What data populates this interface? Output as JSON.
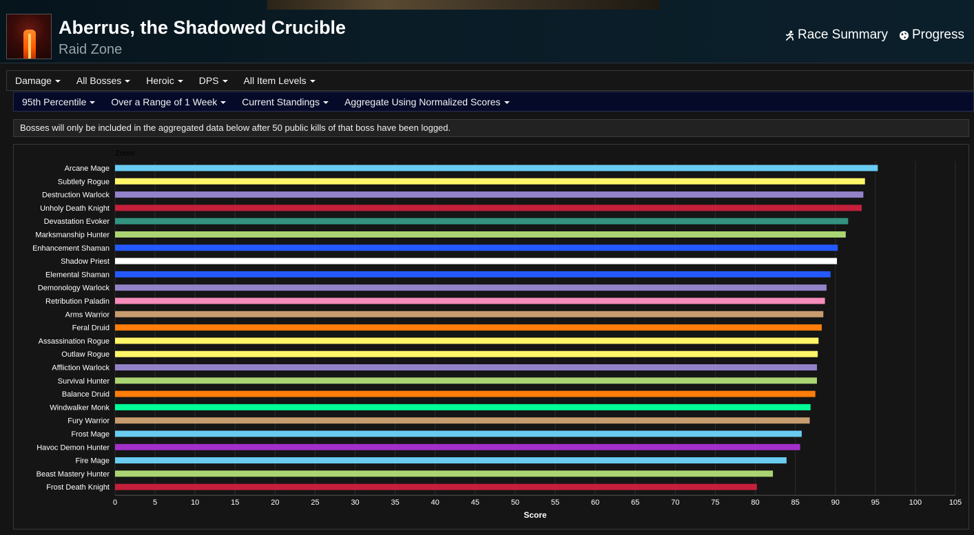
{
  "header": {
    "title": "Aberrus, the Shadowed Crucible",
    "subtitle": "Raid Zone",
    "links": [
      "Race Summary",
      "Progress"
    ]
  },
  "filters_primary": [
    "Damage",
    "All Bosses",
    "Heroic",
    "DPS",
    "All Item Levels"
  ],
  "filters_secondary": [
    "95th Percentile",
    "Over a Range of 1 Week",
    "Current Standings",
    "Aggregate Using Normalized Scores"
  ],
  "notice": "Bosses will only be included in the aggregated data below after 50 public kills of that boss have been logged.",
  "chart_data": {
    "type": "bar",
    "orientation": "horizontal",
    "zoom_label": "Zoom",
    "xlabel": "Score",
    "xlim": [
      0,
      105
    ],
    "xticks": [
      0,
      5,
      10,
      15,
      20,
      25,
      30,
      35,
      40,
      45,
      50,
      55,
      60,
      65,
      70,
      75,
      80,
      85,
      90,
      95,
      100,
      105
    ],
    "grid": "vertical",
    "categories": [
      "Arcane Mage",
      "Subtlety Rogue",
      "Destruction Warlock",
      "Unholy Death Knight",
      "Devastation Evoker",
      "Marksmanship Hunter",
      "Enhancement Shaman",
      "Shadow Priest",
      "Elemental Shaman",
      "Demonology Warlock",
      "Retribution Paladin",
      "Arms Warrior",
      "Feral Druid",
      "Assassination Rogue",
      "Outlaw Rogue",
      "Affliction Warlock",
      "Survival Hunter",
      "Balance Druid",
      "Windwalker Monk",
      "Fury Warrior",
      "Frost Mage",
      "Havoc Demon Hunter",
      "Fire Mage",
      "Beast Mastery Hunter",
      "Frost Death Knight"
    ],
    "values": [
      95.3,
      93.7,
      93.5,
      93.3,
      91.6,
      91.3,
      90.3,
      90.2,
      89.4,
      88.9,
      88.7,
      88.5,
      88.3,
      87.9,
      87.8,
      87.7,
      87.7,
      87.5,
      86.9,
      86.8,
      85.8,
      85.6,
      83.9,
      82.2,
      80.2
    ],
    "colors": [
      "#69ccf0",
      "#fff569",
      "#9482c9",
      "#c41f3b",
      "#33937f",
      "#abd473",
      "#2459ff",
      "#ffffff",
      "#2459ff",
      "#9482c9",
      "#f58cba",
      "#c79c6e",
      "#ff7d0a",
      "#fff569",
      "#fff569",
      "#9482c9",
      "#abd473",
      "#ff7d0a",
      "#00ff96",
      "#c79c6e",
      "#69ccf0",
      "#a330c9",
      "#69ccf0",
      "#abd473",
      "#c41f3b"
    ]
  }
}
